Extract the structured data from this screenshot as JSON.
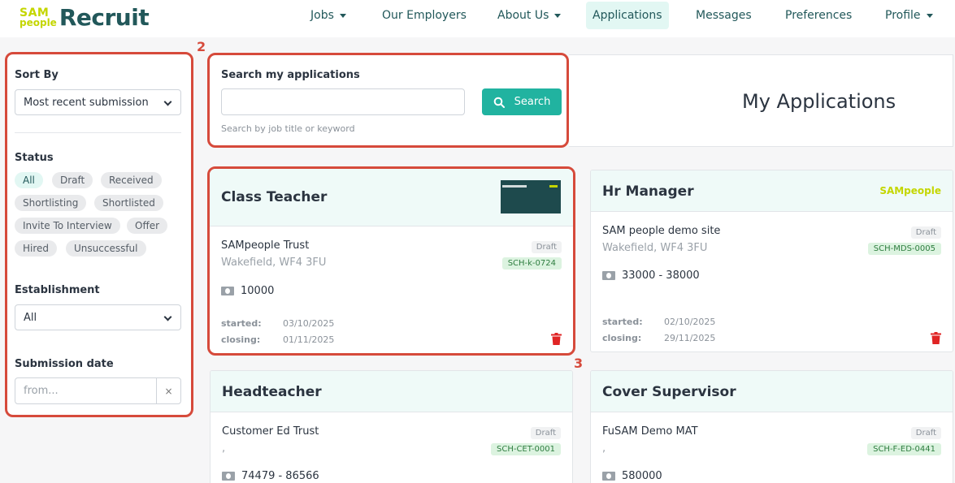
{
  "brand": {
    "sam_top": "SAM",
    "sam_bottom": "people",
    "recruit": "Recruit"
  },
  "nav": {
    "jobs": "Jobs",
    "employers": "Our Employers",
    "about": "About Us",
    "applications": "Applications",
    "messages": "Messages",
    "preferences": "Preferences",
    "profile": "Profile"
  },
  "annotations": {
    "filters": "2",
    "card": "3"
  },
  "filters": {
    "sort_label": "Sort By",
    "sort_value": "Most recent submission",
    "status_label": "Status",
    "statuses": [
      "All",
      "Draft",
      "Received",
      "Shortlisting",
      "Shortlisted",
      "Invite To Interview",
      "Offer",
      "Hired",
      "Unsuccessful"
    ],
    "active_status": "All",
    "establishment_label": "Establishment",
    "establishment_value": "All",
    "submission_label": "Submission date",
    "from_placeholder": "from...",
    "clear": "×"
  },
  "search": {
    "label": "Search my applications",
    "button": "Search",
    "hint": "Search by job title or keyword",
    "value": ""
  },
  "page_title": "My Applications",
  "applications": [
    {
      "title": "Class Teacher",
      "org": "SAMpeople Trust",
      "location": "Wakefield, WF4 3FU",
      "status": "Draft",
      "ref": "SCH-k-0724",
      "salary": "10000",
      "started_label": "started:",
      "started": "03/10/2025",
      "closing_label": "closing:",
      "closing": "01/11/2025"
    },
    {
      "title": "Hr Manager",
      "org": "SAM people demo site",
      "location": "Wakefield, WF4 3FU",
      "status": "Draft",
      "ref": "SCH-MDS-0005",
      "salary": "33000 - 38000",
      "started_label": "started:",
      "started": "02/10/2025",
      "closing_label": "closing:",
      "closing": "29/11/2025",
      "logo_text": "SAMpeople"
    },
    {
      "title": "Headteacher",
      "org": "Customer Ed Trust",
      "location": ",",
      "status": "Draft",
      "ref": "SCH-CET-0001",
      "salary": "74479 - 86566"
    },
    {
      "title": "Cover Supervisor",
      "org": "FuSAM Demo MAT",
      "location": ",",
      "status": "Draft",
      "ref": "SCH-F-ED-0441",
      "salary": "580000"
    }
  ],
  "colors": {
    "accent": "#21b3a0",
    "brand_dark": "#22585a",
    "brand_lime": "#c4d600",
    "annotation": "#d64a3b",
    "delete": "#e02424"
  }
}
